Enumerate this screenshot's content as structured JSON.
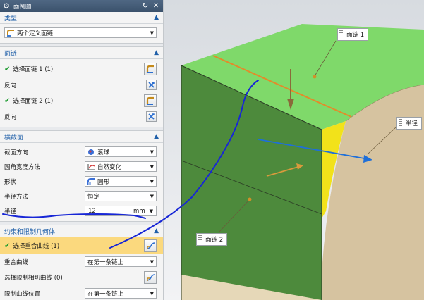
{
  "titlebar": {
    "title": "面倒圆",
    "reset_icon": "reset-icon",
    "close_icon": "close-icon"
  },
  "type_section": {
    "header": "类型",
    "selected": "两个定义面链"
  },
  "face_chain": {
    "header": "面链",
    "select1": "选择面链 1 (1)",
    "reverse1": "反向",
    "select2": "选择面链 2 (1)",
    "reverse2": "反向"
  },
  "cross_section": {
    "header": "横截面",
    "rows": [
      {
        "label": "截面方向",
        "value": "滚球",
        "icon": "ball-icon"
      },
      {
        "label": "圆角宽度方法",
        "value": "自然变化",
        "icon": "curve-icon"
      },
      {
        "label": "形状",
        "value": "圆形",
        "icon": "circle-shape-icon"
      },
      {
        "label": "半径方法",
        "value": "恒定",
        "icon": ""
      }
    ],
    "radius_label": "半径",
    "radius_value": "12",
    "radius_unit": "mm"
  },
  "constraint": {
    "header": "约束和限制几何体",
    "select_coincident": "选择重合曲线 (1)",
    "coincident_label": "重合曲线",
    "coincident_value": "在第一条链上",
    "select_tangent": "选择限制相切曲线 (0)",
    "limit_pos_label": "限制曲线位置",
    "limit_pos_value": "在第一条链上"
  },
  "viewport": {
    "tag1": "面链 1",
    "tag2": "面链 2",
    "tag3": "半径"
  },
  "colors": {
    "top_face": "#7fd96a",
    "front_face": "#4d8a3c",
    "fillet": "#f2e21a",
    "curved_face": "#d6c3a0",
    "accent": "#1f5fa8",
    "highlight": "#fbd97e",
    "scribble": "#1726d6"
  }
}
